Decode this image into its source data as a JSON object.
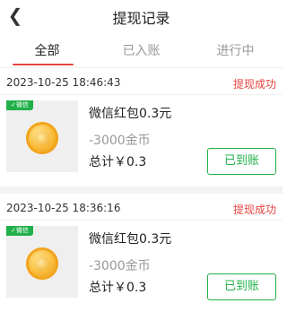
{
  "header": {
    "back_icon": "chevron-left-icon",
    "title": "提现记录"
  },
  "tabs": [
    {
      "label": "全部",
      "active": true
    },
    {
      "label": "已入账",
      "active": false
    },
    {
      "label": "进行中",
      "active": false
    }
  ],
  "colors": {
    "accent_red": "#e64540",
    "wechat_green": "#22b04b"
  },
  "records": [
    {
      "time": "2023-10-25 18:46:43",
      "status": "提现成功",
      "tag": "微信",
      "title": "微信红包0.3元",
      "coins": "-3000金币",
      "total": "总计￥0.3",
      "button": "已到账"
    },
    {
      "time": "2023-10-25 18:36:16",
      "status": "提现成功",
      "tag": "微信",
      "title": "微信红包0.3元",
      "coins": "-3000金币",
      "total": "总计￥0.3",
      "button": "已到账"
    }
  ]
}
